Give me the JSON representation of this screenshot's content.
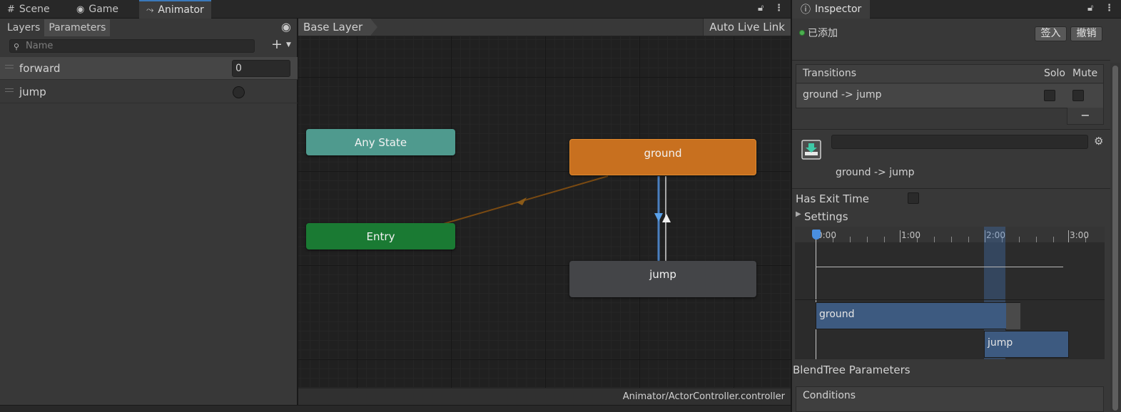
{
  "tabs": [
    {
      "label": "Scene",
      "icon": "hash-icon"
    },
    {
      "label": "Game",
      "icon": "gamepad-icon"
    },
    {
      "label": "Animator",
      "icon": "animator-icon"
    }
  ],
  "params_panel": {
    "tabs": [
      "Layers",
      "Parameters"
    ],
    "search_placeholder": "Name",
    "parameters": [
      {
        "name": "forward",
        "type": "float",
        "value": "0"
      },
      {
        "name": "jump",
        "type": "bool",
        "value": false
      }
    ]
  },
  "graph": {
    "breadcrumb": "Base Layer",
    "auto_live_link": "Auto Live Link",
    "nodes": {
      "any_state": "Any State",
      "entry": "Entry",
      "ground": "ground",
      "jump": "jump"
    },
    "footer_path": "Animator/ActorController.controller",
    "colors": {
      "any_state": "#4f9a8e",
      "entry": "#1a7a33",
      "ground": "#c8701f",
      "jump": "#444548"
    }
  },
  "inspector": {
    "tab_label": "Inspector",
    "added_label": "已添加",
    "sign_in_button": "签入",
    "revert_button": "撤销",
    "transitions": {
      "header": "Transitions",
      "solo": "Solo",
      "mute": "Mute",
      "rows": [
        {
          "label": "ground -> jump"
        }
      ]
    },
    "minus_label": "−",
    "transition_name": "ground -> jump",
    "has_exit_time": "Has Exit Time",
    "settings": "Settings",
    "timeline": {
      "ticks": [
        "0:00",
        "1:00",
        "2:00",
        "3:00"
      ],
      "source_bar": "ground",
      "dest_bar": "jump"
    },
    "blendtree_params": "BlendTree Parameters",
    "conditions": "Conditions"
  }
}
